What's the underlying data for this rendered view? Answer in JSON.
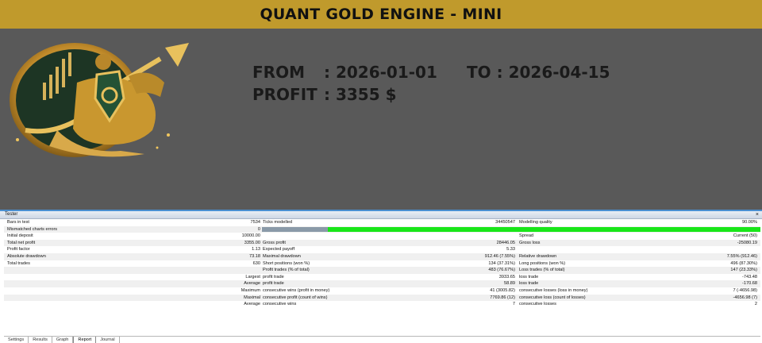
{
  "banner": {
    "title": "QUANT GOLD ENGINE - MINI"
  },
  "info": {
    "from_label": "FROM",
    "from_value": ": 2026-01-01",
    "to_text": "TO : 2026-04-15",
    "profit_label": "PROFIT",
    "profit_value": ": 3355 $"
  },
  "tester": {
    "title": "Tester",
    "close": "×",
    "rows": [
      {
        "l1": "Bars in test",
        "v1": "7534",
        "l2": "Ticks modelled",
        "v2": "34450547",
        "l3": "Modelling quality",
        "v3": "90.00%"
      },
      {
        "l1": "Mismatched charts errors",
        "v1": "0",
        "bar": true
      },
      {
        "l1": "Initial deposit",
        "v1": "10000.00",
        "l3": "Spread",
        "v3": "Current (50)"
      },
      {
        "l1": "Total net profit",
        "v1": "3355.00",
        "l2": "Gross profit",
        "v2": "28446.05",
        "l3": "Gross loss",
        "v3": "-25080.19"
      },
      {
        "l1": "Profit factor",
        "v1": "1.13",
        "l2": "Expected payoff",
        "v2": "5.33"
      },
      {
        "l1": "Absolute drawdown",
        "v1": "73.18",
        "l2": "Maximal drawdown",
        "v2": "912.46 (7.55%)",
        "l3": "Relative drawdown",
        "v3": "7.55% (912.46)"
      },
      {
        "l1": "Total trades",
        "v1": "630",
        "l2": "Short positions (won %)",
        "v2": "134 (37.31%)",
        "l3": "Long positions (won %)",
        "v3": "496 (87.30%)"
      },
      {
        "l2": "Profit trades (% of total)",
        "v2": "483 (76.67%)",
        "l3": "Loss trades (% of total)",
        "v3": "147 (23.33%)"
      },
      {
        "lmid": "Largest",
        "l2": "profit trade",
        "v2": "3933.65",
        "l3": "loss trade",
        "v3": "-743.48"
      },
      {
        "lmid": "Average",
        "l2": "profit trade",
        "v2": "58.89",
        "l3": "loss trade",
        "v3": "-170.68"
      },
      {
        "lmid": "Maximum",
        "l2": "consecutive wins (profit in money)",
        "v2": "41 (3005.82)",
        "l3": "consecutive losses (loss in money)",
        "v3": "7 (-4656.98)"
      },
      {
        "lmid": "Maximal",
        "l2": "consecutive profit (count of wins)",
        "v2": "7769.86 (12)",
        "l3": "consecutive loss (count of losses)",
        "v3": "-4656.98 (7)"
      },
      {
        "lmid": "Average",
        "l2": "consecutive wins",
        "v2": "7",
        "l3": "consecutive losses",
        "v3": "2"
      }
    ],
    "quality_fraction": 0.9,
    "tabs": [
      "Settings",
      "Results",
      "Graph",
      "Report",
      "Journal"
    ],
    "active_tab": "Report"
  }
}
